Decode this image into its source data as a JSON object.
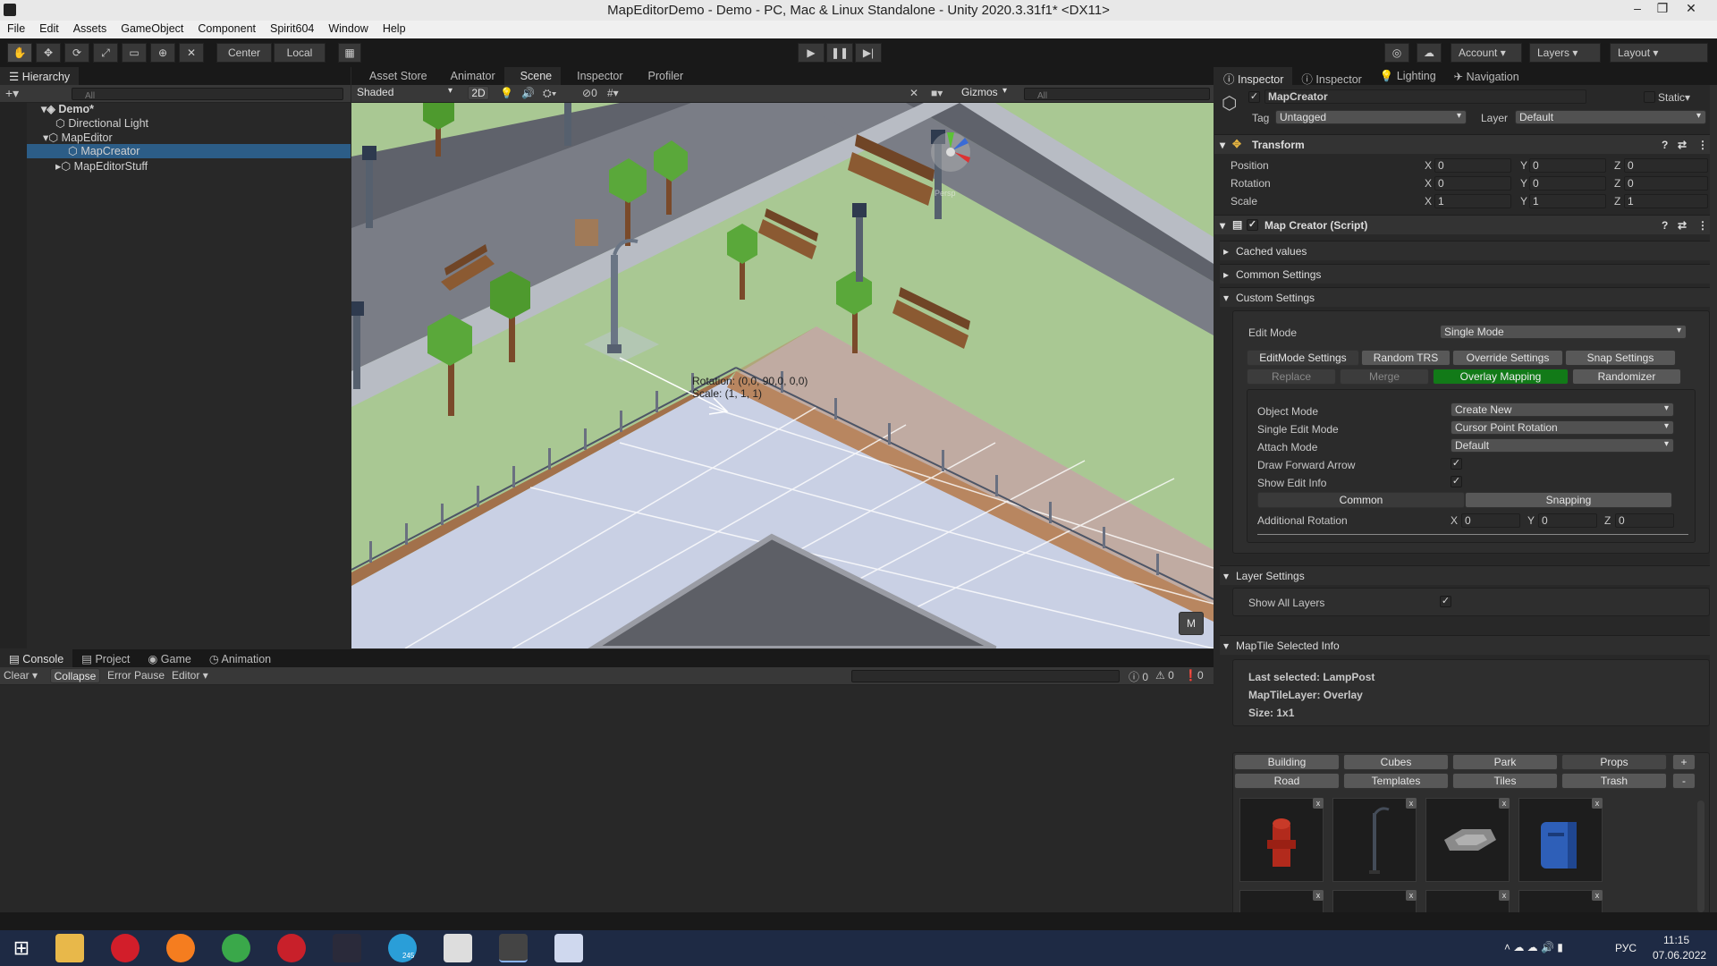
{
  "window": {
    "title": "MapEditorDemo - Demo - PC, Mac & Linux Standalone - Unity 2020.3.31f1* <DX11>"
  },
  "menu": [
    "File",
    "Edit",
    "Assets",
    "GameObject",
    "Component",
    "Spirit604",
    "Window",
    "Help"
  ],
  "toolbar": {
    "center": "Center",
    "local": "Local",
    "account": "Account",
    "layers": "Layers",
    "layout": "Layout"
  },
  "hierarchy": {
    "tab": "Hierarchy",
    "search_placeholder": "All",
    "items": [
      {
        "label": "Demo*"
      },
      {
        "label": "Directional Light"
      },
      {
        "label": "MapEditor"
      },
      {
        "label": "MapCreator"
      },
      {
        "label": "MapEditorStuff"
      }
    ]
  },
  "center_tabs": [
    "Asset Store",
    "Animator",
    "Scene",
    "Inspector",
    "Profiler"
  ],
  "scene": {
    "shading": "Shaded",
    "mode_2d": "2D",
    "hidden_count": "0",
    "gizmos": "Gizmos",
    "search_placeholder": "All",
    "overlay_rotation": "Rotation: (0,0, 90,0, 0,0)",
    "overlay_scale": "Scale: (1, 1, 1)",
    "m_button": "M",
    "persp": "Persp"
  },
  "bottom": {
    "tabs": [
      "Console",
      "Project",
      "Game",
      "Animation"
    ],
    "clear": "Clear",
    "collapse": "Collapse",
    "error_pause": "Error Pause",
    "editor": "Editor",
    "counts": [
      "0",
      "0",
      "0"
    ]
  },
  "inspector_tabs": [
    "Inspector",
    "Inspector",
    "Lighting",
    "Navigation"
  ],
  "inspector": {
    "object_name": "MapCreator",
    "static": "Static",
    "tag_label": "Tag",
    "tag_value": "Untagged",
    "layer_label": "Layer",
    "layer_value": "Default",
    "transform": {
      "title": "Transform",
      "rows": [
        {
          "label": "Position",
          "x": "0",
          "y": "0",
          "z": "0"
        },
        {
          "label": "Rotation",
          "x": "0",
          "y": "0",
          "z": "0"
        },
        {
          "label": "Scale",
          "x": "1",
          "y": "1",
          "z": "1"
        }
      ]
    },
    "script": {
      "title": "Map Creator (Script)",
      "foldouts": [
        "Cached values",
        "Common Settings",
        "Custom Settings"
      ],
      "edit_mode_label": "Edit Mode",
      "edit_mode_value": "Single Mode",
      "tabs_row1": [
        "EditMode Settings",
        "Random TRS",
        "Override Settings",
        "Snap Settings"
      ],
      "tabs_row2": [
        "Replace",
        "Merge",
        "Overlay Mapping",
        "Randomizer"
      ],
      "object_mode_label": "Object Mode",
      "object_mode_value": "Create New",
      "single_edit_label": "Single Edit Mode",
      "single_edit_value": "Cursor Point Rotation",
      "attach_label": "Attach Mode",
      "attach_value": "Default",
      "draw_forward_label": "Draw Forward Arrow",
      "show_edit_label": "Show Edit Info",
      "common_tab": "Common",
      "snapping_tab": "Snapping",
      "additional_rotation_label": "Additional Rotation",
      "add_rot": {
        "x": "0",
        "y": "0",
        "z": "0"
      },
      "layer_settings": "Layer Settings",
      "show_all_layers": "Show All Layers",
      "selected_info": "MapTile Selected Info",
      "last_selected": "Last selected: LampPost",
      "tile_layer": "MapTileLayer: Overlay",
      "size": "Size: 1x1",
      "categories_row1": [
        "Building",
        "Cubes",
        "Park",
        "Props"
      ],
      "categories_row2": [
        "Road",
        "Templates",
        "Tiles",
        "Trash"
      ],
      "plus": "+",
      "minus": "-",
      "close_mark": "x",
      "axis": {
        "x": "X",
        "y": "Y",
        "z": "Z"
      }
    }
  },
  "taskbar": {
    "lang": "РУС",
    "time": "11:15",
    "date": "07.06.2022",
    "telegram_badge": "245"
  },
  "colors": {
    "accent_green": "#127a18",
    "selection": "#2c5d87"
  }
}
